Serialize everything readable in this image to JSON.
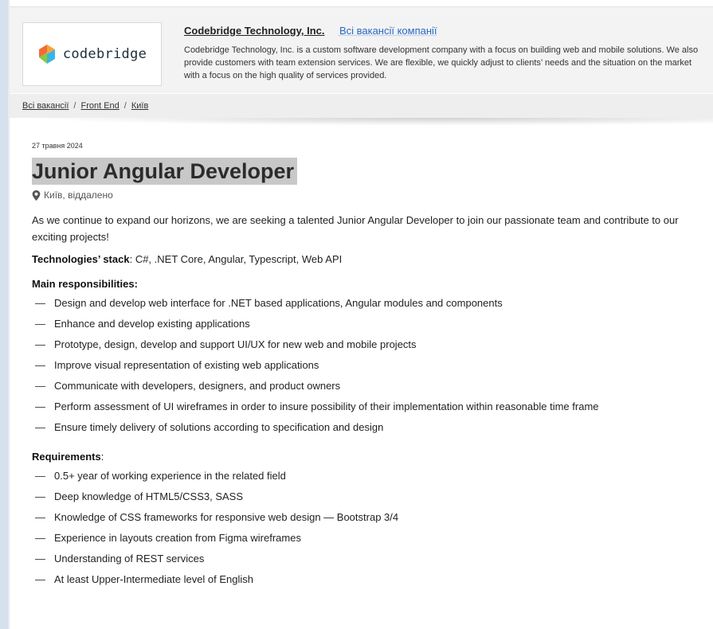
{
  "company": {
    "logo_text": "codebridge",
    "name": "Codebridge Technology, Inc.",
    "all_vacancies_link": "Всі вакансії компанії",
    "description": "Codebridge Technology, Inc. is a custom software development company with a focus on building web and mobile solutions. We also provide customers with team extension services. We are flexible, we quickly adjust to clients’ needs and the situation on the market with a focus on the high quality of services provided.",
    "brand_colors": [
      "#f26b3a",
      "#3ab4e6",
      "#8dc63f"
    ]
  },
  "breadcrumb": [
    {
      "label": "Всі вакансії"
    },
    {
      "label": "Front End"
    },
    {
      "label": "Київ"
    }
  ],
  "vacancy": {
    "date": "27 травня 2024",
    "title": "Junior Angular Developer",
    "location": "Київ, віддалено",
    "intro": "As we continue to expand our horizons, we are seeking a talented Junior Angular Developer to join our passionate team and contribute to our exciting projects!",
    "stack_label": "Technologies’ stack",
    "stack_value": ": C#, .NET Core, Angular, Typescript, Web API",
    "responsibilities_title": "Main responsibilities:",
    "responsibilities": [
      "Design and develop web interface for .NET based applications, Angular modules and components",
      "Enhance and develop existing applications",
      "Prototype, design, develop and support UI/UX for new web and mobile projects",
      "Improve visual representation of existing web applications",
      "Communicate with developers, designers, and product owners",
      "Perform assessment of UI wireframes in order to insure possibility of their implementation within reasonable time frame",
      "Ensure timely delivery of solutions according to specification and design"
    ],
    "requirements_title": "Requirements",
    "requirements_colon": ":",
    "requirements": [
      "0.5+ year of working experience in the related field",
      "Deep knowledge of HTML5/CSS3, SASS",
      "Knowledge of CSS frameworks for responsive web design — Bootstrap 3/4",
      "Experience in layouts creation from Figma wireframes",
      "Understanding of REST services",
      "At least Upper-Intermediate level of English"
    ]
  },
  "icons": {
    "location": "map-pin-icon",
    "logo": "codebridge-logo-icon"
  }
}
